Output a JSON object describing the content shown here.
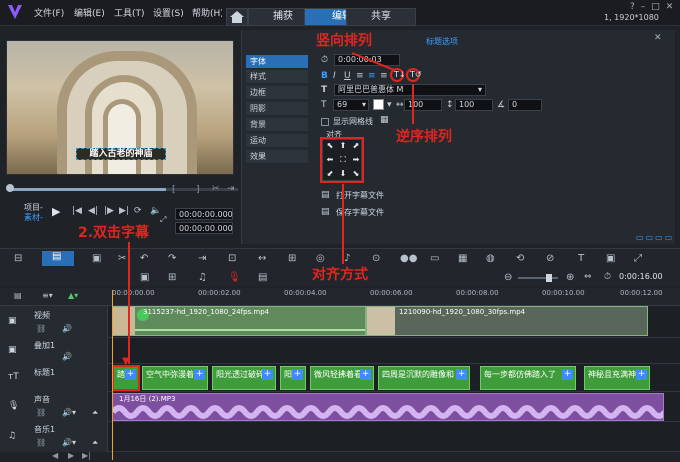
{
  "menu": [
    "文件(F)",
    "编辑(E)",
    "工具(T)",
    "设置(S)",
    "帮助(H)"
  ],
  "tabs": [
    {
      "label": "捕获",
      "active": false
    },
    {
      "label": "编辑",
      "active": true
    },
    {
      "label": "共享",
      "active": false
    }
  ],
  "resolution": "1, 1920*1080",
  "preview": {
    "title_overlay": "踏入古老的神庙"
  },
  "playback": {
    "project_label": "项目-",
    "clip_label": "素材-",
    "timecode_main": "00:00:00.000",
    "timecode_secondary": "00:00:00.000"
  },
  "options": {
    "panel_title": "标题选项",
    "categories": [
      "字体",
      "样式",
      "边框",
      "阴影",
      "背景",
      "运动",
      "效果"
    ],
    "active_category": "字体",
    "duration": "0:00:00:03",
    "font_name": "阿里巴巴普惠体 M",
    "font_size": "69",
    "scale_a": "100",
    "scale_b": "100",
    "rotation": "0",
    "show_grid_label": "显示网格线",
    "align_label": "对齐",
    "open_subtitle": "打开字幕文件",
    "save_subtitle": "保存字幕文件"
  },
  "timeline": {
    "duration": "0:00:16.00",
    "ruler": [
      "00:00:00.00",
      "00:00:02.00",
      "00:00:04.00",
      "00:00:06.00",
      "00:00:08.00",
      "00:00:10.00",
      "00:00:12.00"
    ],
    "tracks": [
      {
        "name": "视频"
      },
      {
        "name": "叠加1"
      },
      {
        "name": "标题1"
      },
      {
        "name": "声音"
      },
      {
        "name": "音乐1"
      }
    ],
    "video_clips": [
      "3115237-hd_1920_1080_24fps.mp4",
      "1210090-hd_1920_1080_30fps.mp4"
    ],
    "title_clips": [
      "踏入",
      "空气中弥漫着",
      "阳光透过破碎",
      "阳光",
      "微风轻拂着看",
      "四周是沉默的雕像和",
      "每一步都仿佛踏入了",
      "神秘且充满神"
    ],
    "audio_clip": "1月16日 (2).MP3"
  },
  "annotations": {
    "vertical": "竖向排列",
    "reverse": "逆序排列",
    "double_click": "2.双击字幕",
    "align": "对齐方式"
  }
}
